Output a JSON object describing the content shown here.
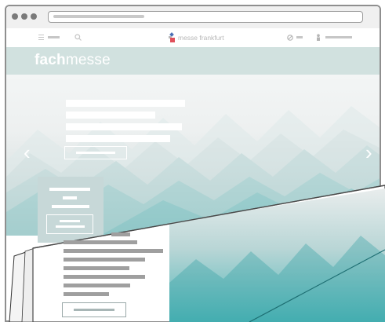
{
  "browser": {
    "window_dots": 3,
    "url_text": ""
  },
  "topbar": {
    "menu_icon": "hamburger-icon",
    "search_icon": "search-icon",
    "logo_text": "messe frankfurt",
    "language_icon": "globe-icon",
    "user_icon": "user-icon"
  },
  "brand": {
    "bold": "fach",
    "light": "messe"
  },
  "hero": {
    "prev_icon": "chevron-left-icon",
    "next_icon": "chevron-right-icon",
    "prev_glyph": "‹",
    "next_glyph": "›",
    "headline_lines": 4,
    "has_cta_button": true
  },
  "colors": {
    "brand_bar": "#d1e1df",
    "hero_teal": "#69c2c2",
    "tile": "#c7d8d8",
    "logo_red": "#e0505b",
    "logo_blue": "#4a6fb5"
  }
}
